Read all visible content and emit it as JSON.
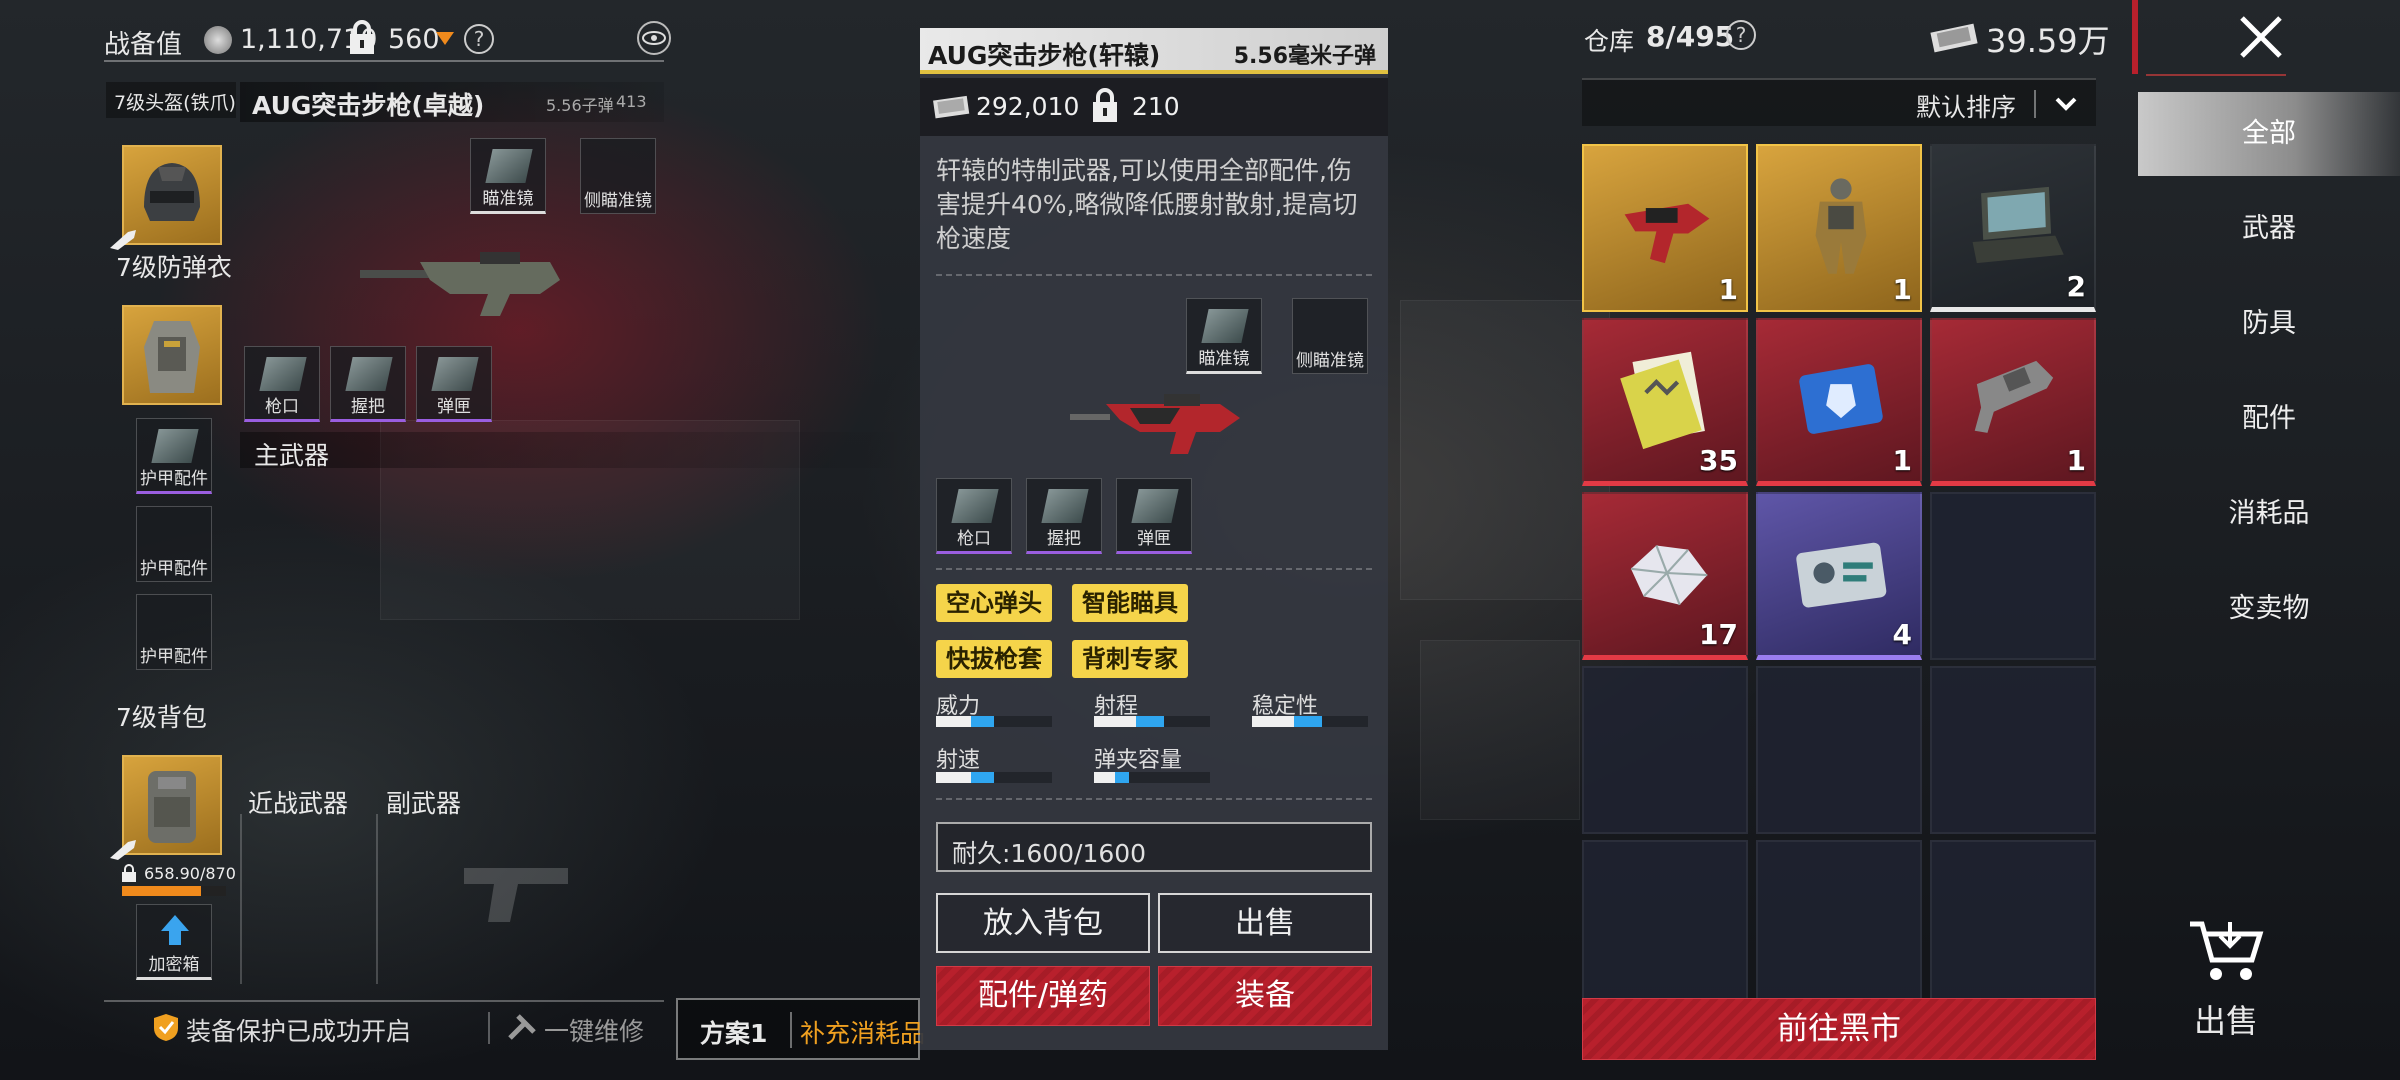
{
  "header": {
    "power_label": "战备值",
    "power_value": "1,110,710",
    "weight_value": "560",
    "help_icon": "question-circle-icon",
    "eye_icon": "eye-icon"
  },
  "loadout": {
    "helmet_label": "7级头盔(铁爪)",
    "weapon_name": "AUG突击步枪(卓越)",
    "weapon_ammo": "5.56子弹",
    "weapon_ammo_count": "413",
    "armor_label": "7级防弹衣",
    "scope_label": "瞄准镜",
    "side_scope_label": "侧瞄准镜",
    "muzzle_label": "枪口",
    "grip_label": "握把",
    "mag_label": "弹匣",
    "primary_weapon_label": "主武器",
    "armor_attachment_label": "护甲配件",
    "backpack_label": "7级背包",
    "melee_label": "近战武器",
    "secondary_label": "副武器",
    "capacity_value": "658.90/870",
    "crate_label": "加密箱",
    "protection_text": "装备保护已成功开启",
    "repair_text": "一键维修",
    "plan_label": "方案1",
    "supply_text": "补充消耗品"
  },
  "detail": {
    "title": "AUG突击步枪(轩辕)",
    "ammo_type": "5.56毫米子弹",
    "price": "292,010",
    "weight": "210",
    "description": "轩辕的特制武器,可以使用全部配件,伤害提升40%,略微降低腰射散射,提高切枪速度",
    "scope_label": "瞄准镜",
    "side_scope_label": "侧瞄准镜",
    "muzzle_label": "枪口",
    "grip_label": "握把",
    "mag_label": "弹匣",
    "tags": [
      "空心弹头",
      "智能瞄具",
      "快拔枪套",
      "背刺专家"
    ],
    "stats": [
      {
        "label": "威力",
        "value": 0.5
      },
      {
        "label": "射程",
        "value": 0.6
      },
      {
        "label": "稳定性",
        "value": 0.6
      },
      {
        "label": "射速",
        "value": 0.5
      },
      {
        "label": "弹夹容量",
        "value": 0.3
      }
    ],
    "durability": "耐久:1600/1600",
    "btn_backpack": "放入背包",
    "btn_sell": "出售",
    "btn_parts": "配件/弹药",
    "btn_equip": "装备"
  },
  "warehouse": {
    "label": "仓库",
    "count": "8/495",
    "money": "39.59万",
    "sort_label": "默认排序",
    "items": [
      {
        "count": "1",
        "rarity": "gold",
        "icon": "rifle-icon"
      },
      {
        "count": "1",
        "rarity": "gold",
        "icon": "armor-suit-icon"
      },
      {
        "count": "2",
        "rarity": "dark",
        "icon": "laptop-icon"
      },
      {
        "count": "35",
        "rarity": "red",
        "icon": "document-icon"
      },
      {
        "count": "1",
        "rarity": "red",
        "icon": "crystal-card-icon"
      },
      {
        "count": "1",
        "rarity": "red",
        "icon": "launcher-icon"
      },
      {
        "count": "17",
        "rarity": "red",
        "icon": "diamond-icon"
      },
      {
        "count": "4",
        "rarity": "purple",
        "icon": "id-card-icon"
      }
    ],
    "black_market_btn": "前往黑市"
  },
  "sidebar": {
    "items": [
      "全部",
      "武器",
      "防具",
      "配件",
      "消耗品",
      "变卖物"
    ],
    "sell_label": "出售"
  },
  "colors": {
    "gold": "#d8a43e",
    "red": "#a62a36",
    "purple": "#5f56a8",
    "tag_yellow": "#f5d44a",
    "accent_red": "#b8202c"
  }
}
